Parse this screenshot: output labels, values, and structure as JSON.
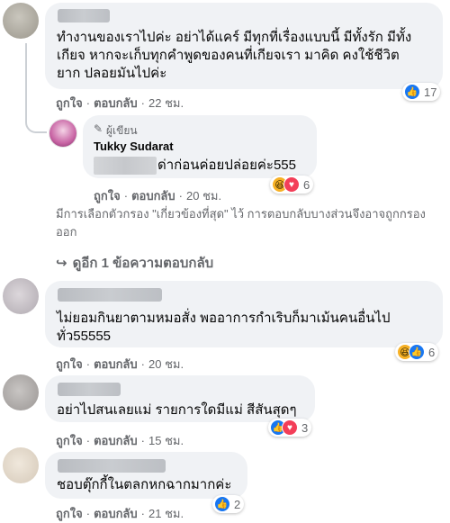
{
  "actions": {
    "like": "ถูกใจ",
    "dot": "·",
    "reply": "ตอบกลับ"
  },
  "comments": [
    {
      "lines": [
        "ทำงานของเราไปค่ะ อย่าได้แคร์ มีทุกที่เรื่องแบบนี้ มีทั้งรัก มีทั้ง",
        "เกียจ หากจะเก็บทุกคำพูดของคนที่เกียจเรา มาคิด คงใช้ชีวิต",
        "ยาก ปลอยมันไปค่ะ"
      ],
      "time": "22 ชม.",
      "reactions": [
        "like-icon"
      ],
      "reaction_count": "17"
    },
    {
      "author_badge": "ผู้เขียน",
      "author": "Tukky Sudarat",
      "text": "ด่าก่อนค่อยปล่อยค่ะ555",
      "time": "20 ชม.",
      "reactions": [
        "haha-icon",
        "love-icon"
      ],
      "reaction_count": "6"
    },
    {
      "lines": [
        "ไม่ยอมกินยาตามหมอสั่ง พออาการกำเริบก็มาเม้นคนอื่นไป",
        "ทั่ว55555"
      ],
      "time": "20 ชม.",
      "reactions": [
        "haha-icon",
        "like-icon"
      ],
      "reaction_count": "6"
    },
    {
      "lines": [
        "อย่าไปสนเลยแม่ รายการใดมีแม่ สีสันสุดๆ"
      ],
      "time": "15 ชม.",
      "reactions": [
        "like-icon",
        "love-icon"
      ],
      "reaction_count": "3"
    },
    {
      "lines": [
        "ชอบตุ๊กกี้ในตลกหกฉากมากค่ะ"
      ],
      "time": "21 ชม.",
      "reactions": [
        "like-icon"
      ],
      "reaction_count": "2"
    }
  ],
  "filter_notice": "มีการเลือกตัวกรอง \"เกี่ยวข้องที่สุด\" ไว้ การตอบกลับบางส่วนจึงอาจถูกกรองออก",
  "more_replies": "ดูอีก 1 ข้อความตอบกลับ",
  "colors": {
    "bubble": "#f0f2f5",
    "secondary_text": "#65676b",
    "like": "#1877f2",
    "love": "#f33e58",
    "haha": "#f7b125"
  }
}
